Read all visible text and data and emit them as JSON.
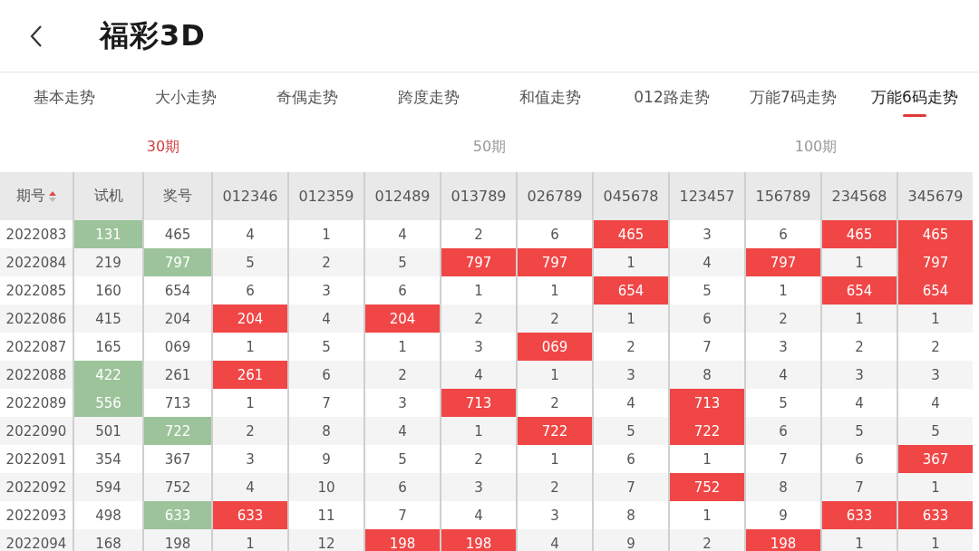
{
  "header": {
    "title": "福彩3D"
  },
  "tabs": [
    {
      "label": "基本走势",
      "selected": false
    },
    {
      "label": "大小走势",
      "selected": false
    },
    {
      "label": "奇偶走势",
      "selected": false
    },
    {
      "label": "跨度走势",
      "selected": false
    },
    {
      "label": "和值走势",
      "selected": false
    },
    {
      "label": "012路走势",
      "selected": false
    },
    {
      "label": "万能7码走势",
      "selected": false
    },
    {
      "label": "万能6码走势",
      "selected": true
    }
  ],
  "periods": [
    {
      "label": "30期",
      "selected": true
    },
    {
      "label": "50期",
      "selected": false
    },
    {
      "label": "100期",
      "selected": false
    }
  ],
  "table": {
    "columns": [
      {
        "label": "期号",
        "kind": "period",
        "sorted": true
      },
      {
        "label": "试机",
        "kind": "draw"
      },
      {
        "label": "奖号",
        "kind": "draw"
      },
      {
        "label": "012346",
        "kind": "combo"
      },
      {
        "label": "012359",
        "kind": "combo"
      },
      {
        "label": "012489",
        "kind": "combo"
      },
      {
        "label": "013789",
        "kind": "combo"
      },
      {
        "label": "026789",
        "kind": "combo"
      },
      {
        "label": "045678",
        "kind": "combo"
      },
      {
        "label": "123457",
        "kind": "combo"
      },
      {
        "label": "156789",
        "kind": "combo"
      },
      {
        "label": "234568",
        "kind": "combo"
      },
      {
        "label": "345679",
        "kind": "combo"
      }
    ],
    "rows": [
      {
        "cells": [
          {
            "v": "2022083",
            "hl": false
          },
          {
            "v": "131",
            "hl": true
          },
          {
            "v": "465",
            "hl": false
          },
          {
            "v": "4",
            "hl": false
          },
          {
            "v": "1",
            "hl": false
          },
          {
            "v": "4",
            "hl": false
          },
          {
            "v": "2",
            "hl": false
          },
          {
            "v": "6",
            "hl": false
          },
          {
            "v": "465",
            "hl": true
          },
          {
            "v": "3",
            "hl": false
          },
          {
            "v": "6",
            "hl": false
          },
          {
            "v": "465",
            "hl": true
          },
          {
            "v": "465",
            "hl": true
          }
        ]
      },
      {
        "cells": [
          {
            "v": "2022084",
            "hl": false
          },
          {
            "v": "219",
            "hl": false
          },
          {
            "v": "797",
            "hl": true
          },
          {
            "v": "5",
            "hl": false
          },
          {
            "v": "2",
            "hl": false
          },
          {
            "v": "5",
            "hl": false
          },
          {
            "v": "797",
            "hl": true
          },
          {
            "v": "797",
            "hl": true
          },
          {
            "v": "1",
            "hl": false
          },
          {
            "v": "4",
            "hl": false
          },
          {
            "v": "797",
            "hl": true
          },
          {
            "v": "1",
            "hl": false
          },
          {
            "v": "797",
            "hl": true
          }
        ]
      },
      {
        "cells": [
          {
            "v": "2022085",
            "hl": false
          },
          {
            "v": "160",
            "hl": false
          },
          {
            "v": "654",
            "hl": false
          },
          {
            "v": "6",
            "hl": false
          },
          {
            "v": "3",
            "hl": false
          },
          {
            "v": "6",
            "hl": false
          },
          {
            "v": "1",
            "hl": false
          },
          {
            "v": "1",
            "hl": false
          },
          {
            "v": "654",
            "hl": true
          },
          {
            "v": "5",
            "hl": false
          },
          {
            "v": "1",
            "hl": false
          },
          {
            "v": "654",
            "hl": true
          },
          {
            "v": "654",
            "hl": true
          }
        ]
      },
      {
        "cells": [
          {
            "v": "2022086",
            "hl": false
          },
          {
            "v": "415",
            "hl": false
          },
          {
            "v": "204",
            "hl": false
          },
          {
            "v": "204",
            "hl": true
          },
          {
            "v": "4",
            "hl": false
          },
          {
            "v": "204",
            "hl": true
          },
          {
            "v": "2",
            "hl": false
          },
          {
            "v": "2",
            "hl": false
          },
          {
            "v": "1",
            "hl": false
          },
          {
            "v": "6",
            "hl": false
          },
          {
            "v": "2",
            "hl": false
          },
          {
            "v": "1",
            "hl": false
          },
          {
            "v": "1",
            "hl": false
          }
        ]
      },
      {
        "cells": [
          {
            "v": "2022087",
            "hl": false
          },
          {
            "v": "165",
            "hl": false
          },
          {
            "v": "069",
            "hl": false
          },
          {
            "v": "1",
            "hl": false
          },
          {
            "v": "5",
            "hl": false
          },
          {
            "v": "1",
            "hl": false
          },
          {
            "v": "3",
            "hl": false
          },
          {
            "v": "069",
            "hl": true
          },
          {
            "v": "2",
            "hl": false
          },
          {
            "v": "7",
            "hl": false
          },
          {
            "v": "3",
            "hl": false
          },
          {
            "v": "2",
            "hl": false
          },
          {
            "v": "2",
            "hl": false
          }
        ]
      },
      {
        "cells": [
          {
            "v": "2022088",
            "hl": false
          },
          {
            "v": "422",
            "hl": true
          },
          {
            "v": "261",
            "hl": false
          },
          {
            "v": "261",
            "hl": true
          },
          {
            "v": "6",
            "hl": false
          },
          {
            "v": "2",
            "hl": false
          },
          {
            "v": "4",
            "hl": false
          },
          {
            "v": "1",
            "hl": false
          },
          {
            "v": "3",
            "hl": false
          },
          {
            "v": "8",
            "hl": false
          },
          {
            "v": "4",
            "hl": false
          },
          {
            "v": "3",
            "hl": false
          },
          {
            "v": "3",
            "hl": false
          }
        ]
      },
      {
        "cells": [
          {
            "v": "2022089",
            "hl": false
          },
          {
            "v": "556",
            "hl": true
          },
          {
            "v": "713",
            "hl": false
          },
          {
            "v": "1",
            "hl": false
          },
          {
            "v": "7",
            "hl": false
          },
          {
            "v": "3",
            "hl": false
          },
          {
            "v": "713",
            "hl": true
          },
          {
            "v": "2",
            "hl": false
          },
          {
            "v": "4",
            "hl": false
          },
          {
            "v": "713",
            "hl": true
          },
          {
            "v": "5",
            "hl": false
          },
          {
            "v": "4",
            "hl": false
          },
          {
            "v": "4",
            "hl": false
          }
        ]
      },
      {
        "cells": [
          {
            "v": "2022090",
            "hl": false
          },
          {
            "v": "501",
            "hl": false
          },
          {
            "v": "722",
            "hl": true
          },
          {
            "v": "2",
            "hl": false
          },
          {
            "v": "8",
            "hl": false
          },
          {
            "v": "4",
            "hl": false
          },
          {
            "v": "1",
            "hl": false
          },
          {
            "v": "722",
            "hl": true
          },
          {
            "v": "5",
            "hl": false
          },
          {
            "v": "722",
            "hl": true
          },
          {
            "v": "6",
            "hl": false
          },
          {
            "v": "5",
            "hl": false
          },
          {
            "v": "5",
            "hl": false
          }
        ]
      },
      {
        "cells": [
          {
            "v": "2022091",
            "hl": false
          },
          {
            "v": "354",
            "hl": false
          },
          {
            "v": "367",
            "hl": false
          },
          {
            "v": "3",
            "hl": false
          },
          {
            "v": "9",
            "hl": false
          },
          {
            "v": "5",
            "hl": false
          },
          {
            "v": "2",
            "hl": false
          },
          {
            "v": "1",
            "hl": false
          },
          {
            "v": "6",
            "hl": false
          },
          {
            "v": "1",
            "hl": false
          },
          {
            "v": "7",
            "hl": false
          },
          {
            "v": "6",
            "hl": false
          },
          {
            "v": "367",
            "hl": true
          }
        ]
      },
      {
        "cells": [
          {
            "v": "2022092",
            "hl": false
          },
          {
            "v": "594",
            "hl": false
          },
          {
            "v": "752",
            "hl": false
          },
          {
            "v": "4",
            "hl": false
          },
          {
            "v": "10",
            "hl": false
          },
          {
            "v": "6",
            "hl": false
          },
          {
            "v": "3",
            "hl": false
          },
          {
            "v": "2",
            "hl": false
          },
          {
            "v": "7",
            "hl": false
          },
          {
            "v": "752",
            "hl": true
          },
          {
            "v": "8",
            "hl": false
          },
          {
            "v": "7",
            "hl": false
          },
          {
            "v": "1",
            "hl": false
          }
        ]
      },
      {
        "cells": [
          {
            "v": "2022093",
            "hl": false
          },
          {
            "v": "498",
            "hl": false
          },
          {
            "v": "633",
            "hl": true
          },
          {
            "v": "633",
            "hl": true
          },
          {
            "v": "11",
            "hl": false
          },
          {
            "v": "7",
            "hl": false
          },
          {
            "v": "4",
            "hl": false
          },
          {
            "v": "3",
            "hl": false
          },
          {
            "v": "8",
            "hl": false
          },
          {
            "v": "1",
            "hl": false
          },
          {
            "v": "9",
            "hl": false
          },
          {
            "v": "633",
            "hl": true
          },
          {
            "v": "633",
            "hl": true
          }
        ]
      },
      {
        "cells": [
          {
            "v": "2022094",
            "hl": false
          },
          {
            "v": "168",
            "hl": false
          },
          {
            "v": "198",
            "hl": false
          },
          {
            "v": "1",
            "hl": false
          },
          {
            "v": "12",
            "hl": false
          },
          {
            "v": "198",
            "hl": true
          },
          {
            "v": "198",
            "hl": true
          },
          {
            "v": "4",
            "hl": false
          },
          {
            "v": "9",
            "hl": false
          },
          {
            "v": "2",
            "hl": false
          },
          {
            "v": "198",
            "hl": true
          },
          {
            "v": "1",
            "hl": false
          },
          {
            "v": "1",
            "hl": false
          }
        ]
      }
    ]
  }
}
